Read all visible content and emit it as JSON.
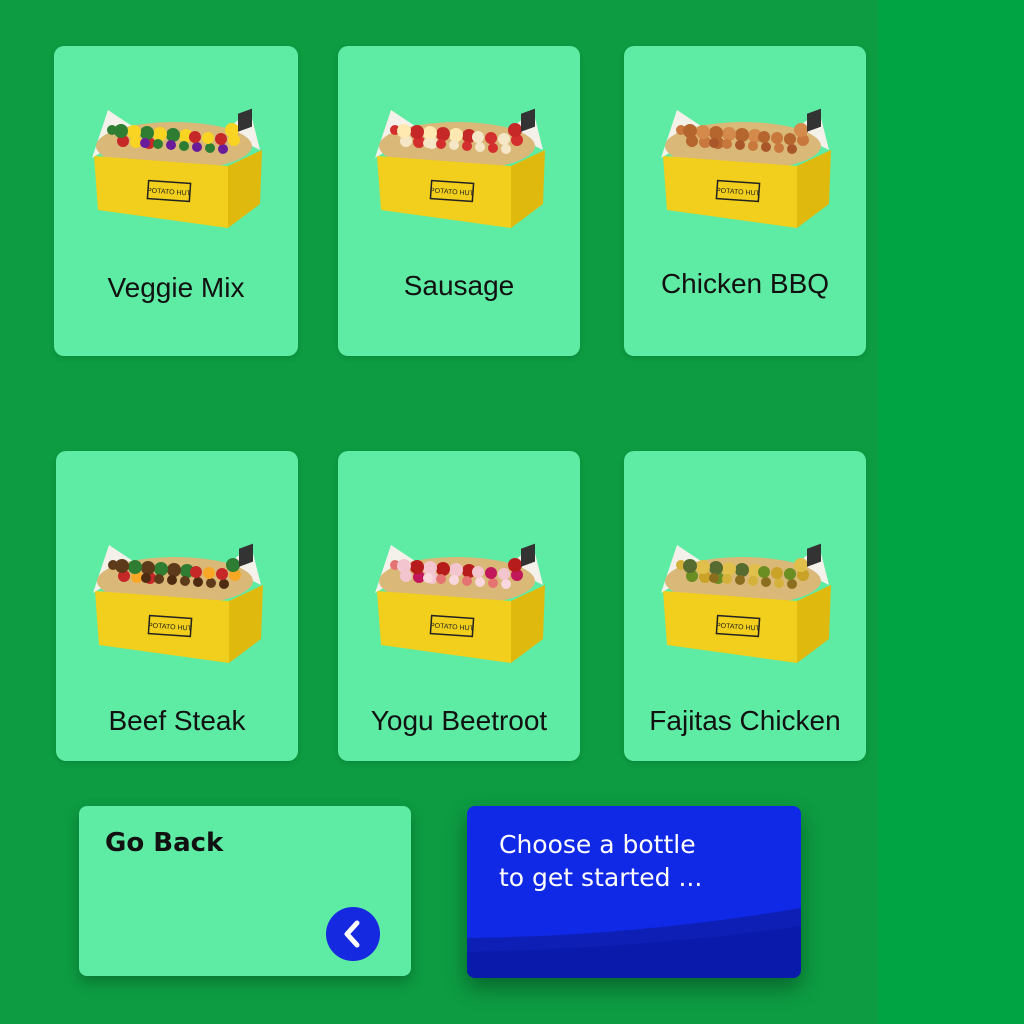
{
  "colors": {
    "background": "#00a443",
    "panel": "#0d9c42",
    "card": "#5eeba3",
    "accent_blue": "#1029e6",
    "box_yellow": "#f2cf1c",
    "potato": "#d9b878"
  },
  "menu": {
    "items": [
      {
        "label": "Veggie Mix",
        "image": "veggie-mix-potato-box-image"
      },
      {
        "label": "Sausage",
        "image": "sausage-potato-box-image"
      },
      {
        "label": "Chicken BBQ",
        "image": "chicken-bbq-potato-box-image"
      },
      {
        "label": "Beef Steak",
        "image": "beef-steak-potato-box-image"
      },
      {
        "label": "Yogu Beetroot",
        "image": "yogu-beetroot-potato-box-image"
      },
      {
        "label": "Fajitas Chicken",
        "image": "fajitas-chicken-potato-box-image"
      }
    ],
    "box_brand": "POTATO HUT"
  },
  "back": {
    "label": "Go Back",
    "icon": "chevron-left-icon"
  },
  "info": {
    "line1": "Choose a bottle",
    "line2": "to get started ..."
  }
}
